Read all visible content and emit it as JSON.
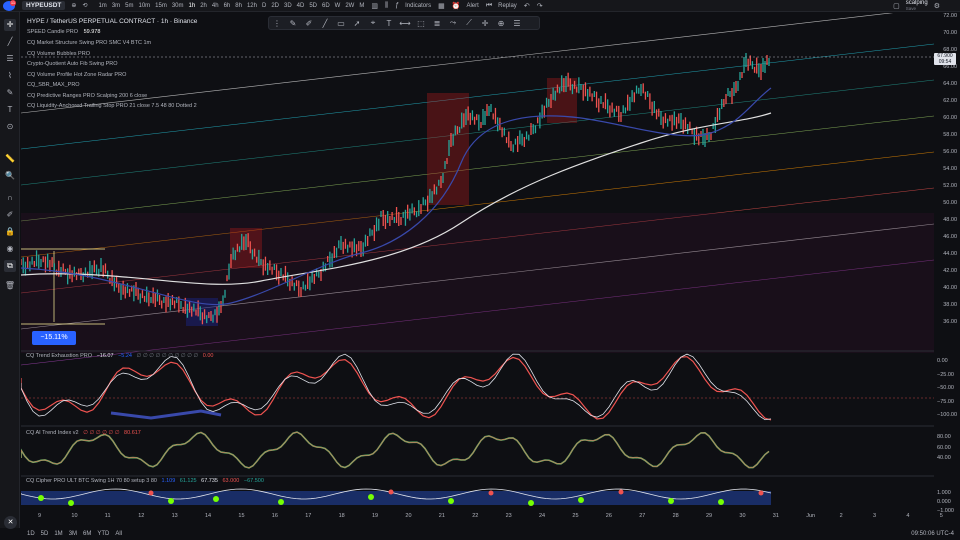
{
  "topbar": {
    "notification_count": "11",
    "ticker": "HYPEUSDT",
    "timeframes": [
      "1m",
      "3m",
      "5m",
      "10m",
      "15m",
      "30m",
      "1h",
      "2h",
      "4h",
      "6h",
      "8h",
      "12h",
      "D",
      "2D",
      "3D",
      "4D",
      "5D",
      "6D",
      "W",
      "2W",
      "M"
    ],
    "active_timeframe": "1h",
    "indicators_label": "Indicators",
    "alert_label": "Alert",
    "replay_label": "Replay",
    "layout_name": "scalping",
    "layout_status": "Save"
  },
  "legend": {
    "main": "HYPE / TetherUS PERPETUAL CONTRACT · 1h · Binance",
    "speed_candle": "SPEED Candle PRO",
    "speed_value": "59.978",
    "lines": [
      "CQ Market Structure Swing PRO SMC V4 BTC 1m",
      "CQ Volume Bubbles PRO",
      "Crypto-Quotient Auto Fib Swing PRO",
      "CQ Volume Profile Hot Zone Radar PRO",
      "CQ_SBR_MAX_PRO",
      "CQ Predictive Ranges PRO Scalping 200 6 close",
      "CQ Liquidity-Anchored Trailing Stop PRO 21 close 7.5 48 80 Dotted 2"
    ]
  },
  "price_axis": [
    "72.00",
    "70.00",
    "68.00",
    "66.00",
    "64.00",
    "62.00",
    "60.00",
    "58.00",
    "56.00",
    "54.00",
    "52.00",
    "50.00",
    "48.00",
    "46.00",
    "44.00",
    "42.00",
    "40.00",
    "38.00",
    "36.00"
  ],
  "current_price": "67.900",
  "countdown": "09:54",
  "measure_label": "−15.11%",
  "panes": {
    "trend_exhaustion": {
      "title": "CQ Trend Exhaustion PRO",
      "v1": "−16.07",
      "v2": "−5.24",
      "v3": "0.00",
      "axis": [
        "0.00",
        "−25.00",
        "−50.00",
        "−75.00",
        "−100.00"
      ]
    },
    "trend_index": {
      "title": "CQ AI Trend Index v2",
      "v1": "80.617",
      "axis": [
        "80.00",
        "60.00",
        "40.00"
      ]
    },
    "cipher": {
      "title": "CQ Cipher PRO ULT BTC Swing 1H 70 80 setup 3 80",
      "v1": "1.109",
      "v2": "61.125",
      "v3": "67.735",
      "v4": "63.000",
      "v5": "−67.500",
      "axis": [
        "1.000",
        "0.000",
        "−1.000"
      ]
    }
  },
  "date_axis": [
    "9",
    "10",
    "11",
    "12",
    "13",
    "14",
    "15",
    "16",
    "17",
    "18",
    "19",
    "20",
    "21",
    "22",
    "23",
    "24",
    "25",
    "26",
    "27",
    "28",
    "29",
    "30",
    "31",
    "Jun",
    "2",
    "3",
    "4",
    "5"
  ],
  "bottombar": {
    "ranges": [
      "1D",
      "5D",
      "1M",
      "3M",
      "6M",
      "YTD",
      "All"
    ],
    "clock": "09:50:06 UTC-4"
  },
  "colors": {
    "bull": "#26a69a",
    "bear": "#ef5350",
    "accent": "#2962ff",
    "ma_white": "#e0e0e0",
    "ma_blue": "#3f51b5"
  }
}
